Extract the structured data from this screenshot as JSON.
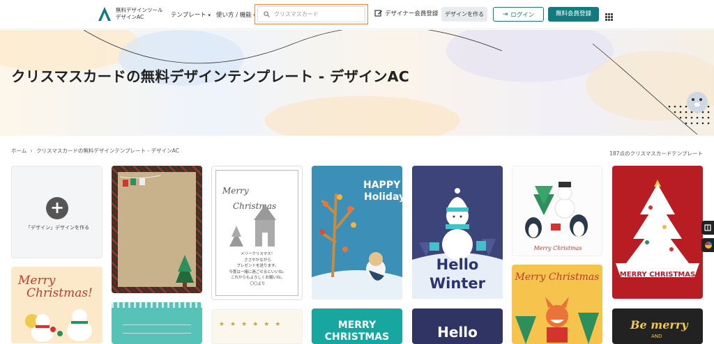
{
  "header": {
    "logo_line1": "無料デザインツール",
    "logo_line2": "デザインAC",
    "nav_templates": "テンプレート",
    "nav_usage": "使い方 / 機能",
    "search_placeholder": "クリスマスカード",
    "designer_register": "デザイナー会員登録",
    "create_design": "デザインを作る",
    "login": "ログイン",
    "free_register": "無料会員登録",
    "accent_color": "#137a7f",
    "search_border_color": "#f0883e"
  },
  "hero": {
    "title": "クリスマスカードの無料デザインテンプレート - デザインAC"
  },
  "breadcrumb": {
    "home": "ホーム",
    "separator": "›",
    "current": "クリスマスカードの無料デザインテンプレート - デザインAC"
  },
  "results_count": "187点のクリスマスカードテンプレート",
  "create_card": {
    "label": "「デザイン」デザインを作る",
    "icon": "plus-icon"
  },
  "cards": {
    "merry_christmas_gray": {
      "line1": "Merry",
      "line2": "Christmas",
      "message1": "メリークリスマス！",
      "message2": "ささやかながら",
      "message3": "プレゼントを送ります。",
      "message4": "今度は一緒に過ごせるといいね。",
      "message5": "これからもよろしくお願いね。",
      "message6": "〇〇より"
    },
    "happy_holiday": {
      "line1": "HAPPY",
      "line2": "Holiday"
    },
    "hello_winter": {
      "line1": "Hello",
      "line2": "Winter"
    },
    "penguins": {
      "caption": "Merry Christmas"
    },
    "red_tree": {
      "banner": "MERRY CHRISTMAS"
    },
    "bears": {
      "line1": "Merry",
      "line2": "Christmas!"
    },
    "fox": {
      "line1": "Merry Christmas"
    },
    "teal_merry": {
      "line1": "MERRY",
      "line2": "CHRISTMAS"
    },
    "navy_hello": {
      "line1": "Hello"
    },
    "be_merry": {
      "line1": "Be merry",
      "line2": "AND"
    }
  }
}
